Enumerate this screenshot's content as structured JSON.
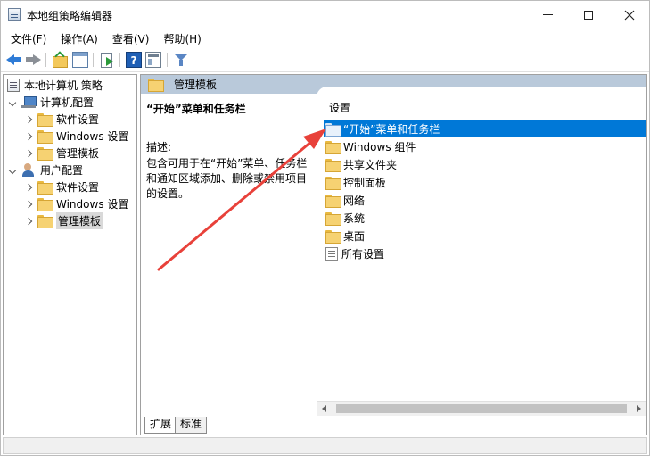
{
  "window": {
    "title": "本地组策略编辑器"
  },
  "menu": [
    {
      "label": "文件(F)"
    },
    {
      "label": "操作(A)"
    },
    {
      "label": "查看(V)"
    },
    {
      "label": "帮助(H)"
    }
  ],
  "toolbar": {
    "help_glyph": "?",
    "icons": [
      "back-arrow-icon",
      "forward-arrow-icon",
      "folder-up-icon",
      "show-panes-icon",
      "export-list-icon",
      "help-icon",
      "view-icon",
      "filter-icon"
    ]
  },
  "tree": {
    "root": "本地计算机 策略",
    "computer_config": "计算机配置",
    "computer_children": [
      "软件设置",
      "Windows 设置",
      "管理模板"
    ],
    "user_config": "用户配置",
    "user_children": [
      "软件设置",
      "Windows 设置",
      "管理模板"
    ]
  },
  "right": {
    "header_title": "管理模板",
    "desc_title": "“开始”菜单和任务栏",
    "desc_label": "描述:",
    "desc_text": "包含可用于在“开始”菜单、任务栏和通知区域添加、删除或禁用项目的设置。",
    "list_header": "设置",
    "items": [
      {
        "label": "“开始”菜单和任务栏"
      },
      {
        "label": "Windows 组件"
      },
      {
        "label": "共享文件夹"
      },
      {
        "label": "控制面板"
      },
      {
        "label": "网络"
      },
      {
        "label": "系统"
      },
      {
        "label": "桌面"
      },
      {
        "label": "所有设置"
      }
    ]
  },
  "tabs": {
    "expanded": "扩展",
    "standard": "标准"
  },
  "colors": {
    "selection": "#0078d7",
    "header_band": "#b9c9da",
    "annotation_arrow": "#e8413a"
  }
}
